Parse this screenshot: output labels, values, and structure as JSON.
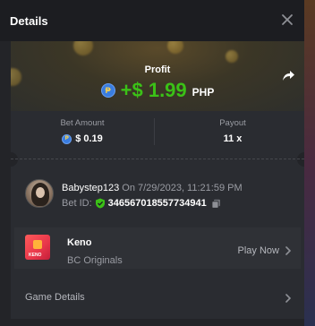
{
  "header": {
    "title": "Details"
  },
  "profit": {
    "label": "Profit",
    "value": "+$ 1.99",
    "currency": "PHP",
    "coin_symbol": "₱"
  },
  "stats": {
    "bet_amount_label": "Bet Amount",
    "bet_amount_value": "$ 0.19",
    "payout_label": "Payout",
    "payout_value": "11 x"
  },
  "user": {
    "name": "Babystep123",
    "date_text": "On 7/29/2023, 11:21:59 PM",
    "bet_id_label": "Bet ID:",
    "bet_id_value": "346567018557734941"
  },
  "game": {
    "thumb_text": "KENO",
    "name": "Keno",
    "provider": "BC Originals",
    "play_label": "Play Now"
  },
  "details": {
    "label": "Game Details"
  },
  "colors": {
    "profit_green": "#3bc117",
    "panel_bg": "#232428",
    "card_bg": "#2a2c31"
  }
}
